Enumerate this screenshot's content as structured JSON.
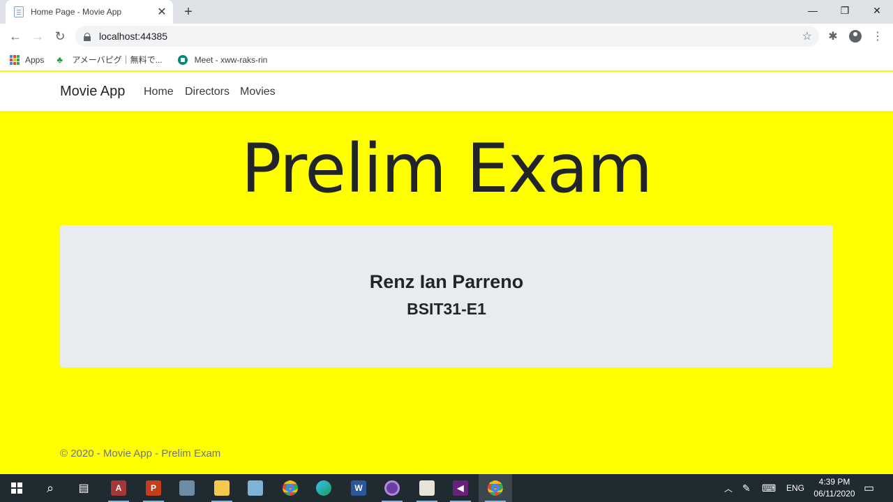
{
  "browser": {
    "tab_title": "Home Page - Movie App",
    "url": "localhost:44385",
    "bookmarks": [
      "Apps",
      "アメーバピグ｜無料で...",
      "Meet - xww-raks-rin"
    ]
  },
  "navbar": {
    "brand": "Movie App",
    "links": [
      "Home",
      "Directors",
      "Movies"
    ]
  },
  "hero": {
    "title": "Prelim Exam"
  },
  "card": {
    "name": "Renz Ian Parreno",
    "section": "BSIT31-E1"
  },
  "footer": {
    "text": "© 2020 - Movie App - Prelim Exam"
  },
  "taskbar": {
    "apps": [
      "start",
      "search",
      "task-view",
      "access",
      "powerpoint",
      "control-panel",
      "file-explorer",
      "notepad",
      "chrome",
      "edge",
      "word",
      "app-purple",
      "paint",
      "visual-studio",
      "chrome-active"
    ],
    "tray_language": "ENG",
    "time": "4:39 PM",
    "date": "06/11/2020"
  },
  "colors": {
    "page_background": "#ffff00",
    "jumbotron": "#e9ecef"
  }
}
